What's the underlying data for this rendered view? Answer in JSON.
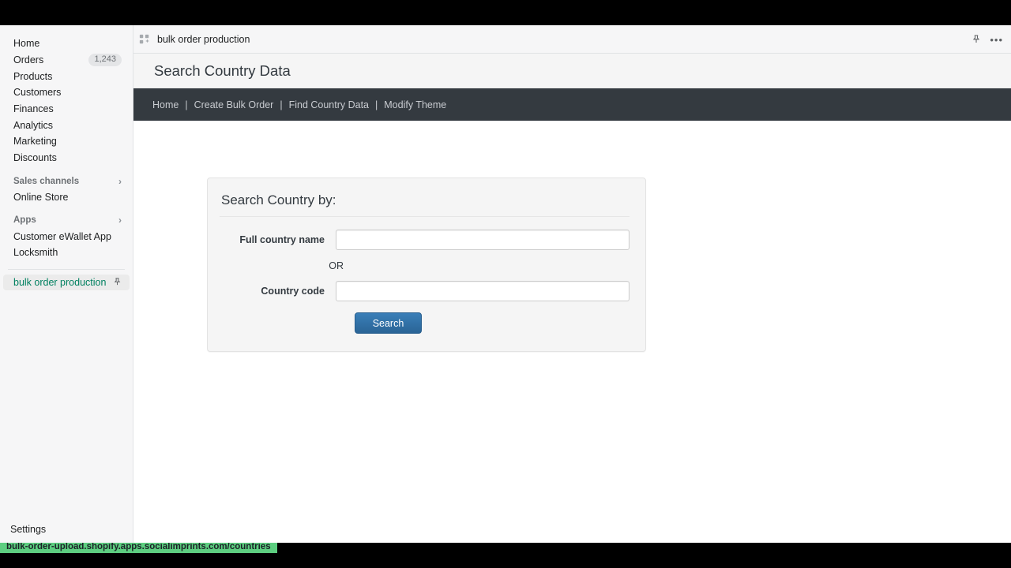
{
  "sidebar": {
    "items": [
      {
        "label": "Home",
        "badge": ""
      },
      {
        "label": "Orders",
        "badge": "1,243"
      },
      {
        "label": "Products",
        "badge": ""
      },
      {
        "label": "Customers",
        "badge": ""
      },
      {
        "label": "Finances",
        "badge": ""
      },
      {
        "label": "Analytics",
        "badge": ""
      },
      {
        "label": "Marketing",
        "badge": ""
      },
      {
        "label": "Discounts",
        "badge": ""
      }
    ],
    "sections": [
      {
        "title": "Sales channels",
        "chevron": "›",
        "items": [
          {
            "label": "Online Store"
          }
        ]
      },
      {
        "title": "Apps",
        "chevron": "›",
        "items": [
          {
            "label": "Customer eWallet App"
          },
          {
            "label": "Locksmith"
          }
        ]
      }
    ],
    "active_app": {
      "label": "bulk order production",
      "pin_icon": "pin-icon"
    },
    "settings_label": "Settings"
  },
  "app_bar": {
    "icon": "apps-grid-icon",
    "title": "bulk order production",
    "pin_icon": "pin-icon",
    "more_icon": "more-options-icon",
    "more_glyph": "•••"
  },
  "page": {
    "title": "Search Country Data"
  },
  "navbar": {
    "links": [
      {
        "label": "Home",
        "separator": "|"
      },
      {
        "label": "Create Bulk Order",
        "separator": "|"
      },
      {
        "label": "Find Country Data",
        "separator": "|"
      },
      {
        "label": "Modify Theme",
        "separator": ""
      }
    ]
  },
  "search_card": {
    "title": "Search Country by:",
    "full_name_label": "Full country name",
    "full_name_value": "",
    "full_name_placeholder": "",
    "or_label": "OR",
    "country_code_label": "Country code",
    "country_code_value": "",
    "country_code_placeholder": "",
    "search_button": "Search"
  },
  "status_bar": {
    "url": "bulk-order-upload.shopify.apps.socialimprints.com/countries"
  },
  "colors": {
    "navbar_dark": "#343a40",
    "primary_blue": "#2e6da4",
    "accent_green": "#008060",
    "status_green": "#5dce80"
  }
}
